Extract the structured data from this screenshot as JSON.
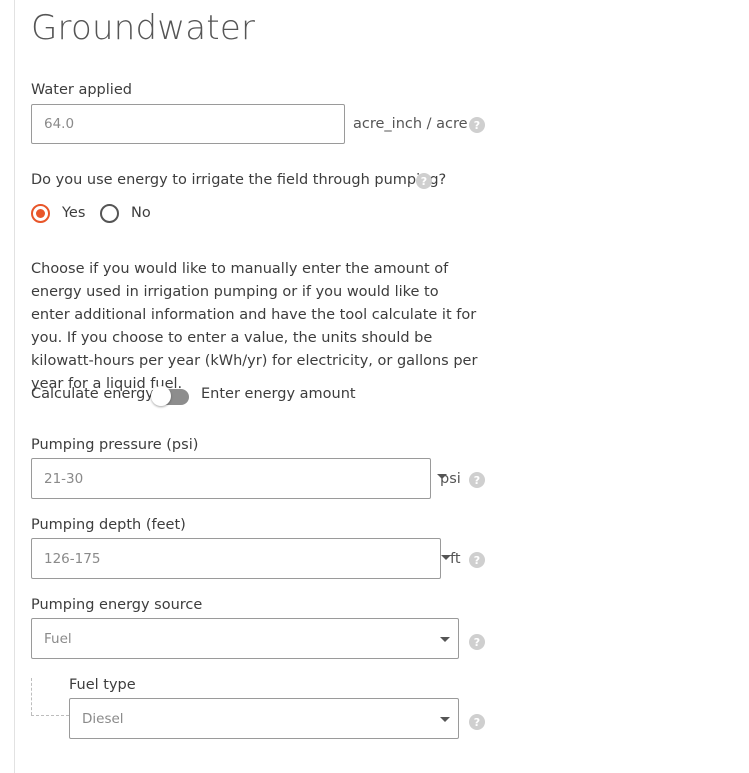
{
  "section": {
    "title": "Groundwater"
  },
  "water_applied": {
    "label": "Water applied",
    "value": "64.0",
    "unit": "acre_inch / acre"
  },
  "energy_question": {
    "label": "Do you use energy to irrigate the field through pumping?",
    "options": [
      {
        "label": "Yes",
        "selected": true
      },
      {
        "label": "No",
        "selected": false
      }
    ]
  },
  "energy_description": "Choose if you would like to manually enter the amount of energy used in irrigation pumping or if you would like to enter additional information and have the tool calculate it for you. If you choose to enter a value, the units should be kilowatt-hours per year (kWh/yr) for electricity, or gallons per year for a liquid fuel.",
  "energy_mode": {
    "left_label": "Calculate energy",
    "right_label": "Enter energy amount",
    "enter_mode": false
  },
  "pumping_pressure": {
    "label": "Pumping pressure (psi)",
    "value": "21-30",
    "unit": "psi"
  },
  "pumping_depth": {
    "label": "Pumping depth (feet)",
    "value": "126-175",
    "unit": "ft"
  },
  "energy_source": {
    "label": "Pumping energy source",
    "value": "Fuel"
  },
  "fuel_type": {
    "label": "Fuel type",
    "value": "Diesel"
  },
  "help_glyph": "?",
  "colors": {
    "accent": "#e8562a",
    "border": "#9a9a9a",
    "help": "#cfcfcf"
  },
  "icons": {
    "help": "question-circle-icon",
    "dropdown": "caret-down-icon"
  }
}
